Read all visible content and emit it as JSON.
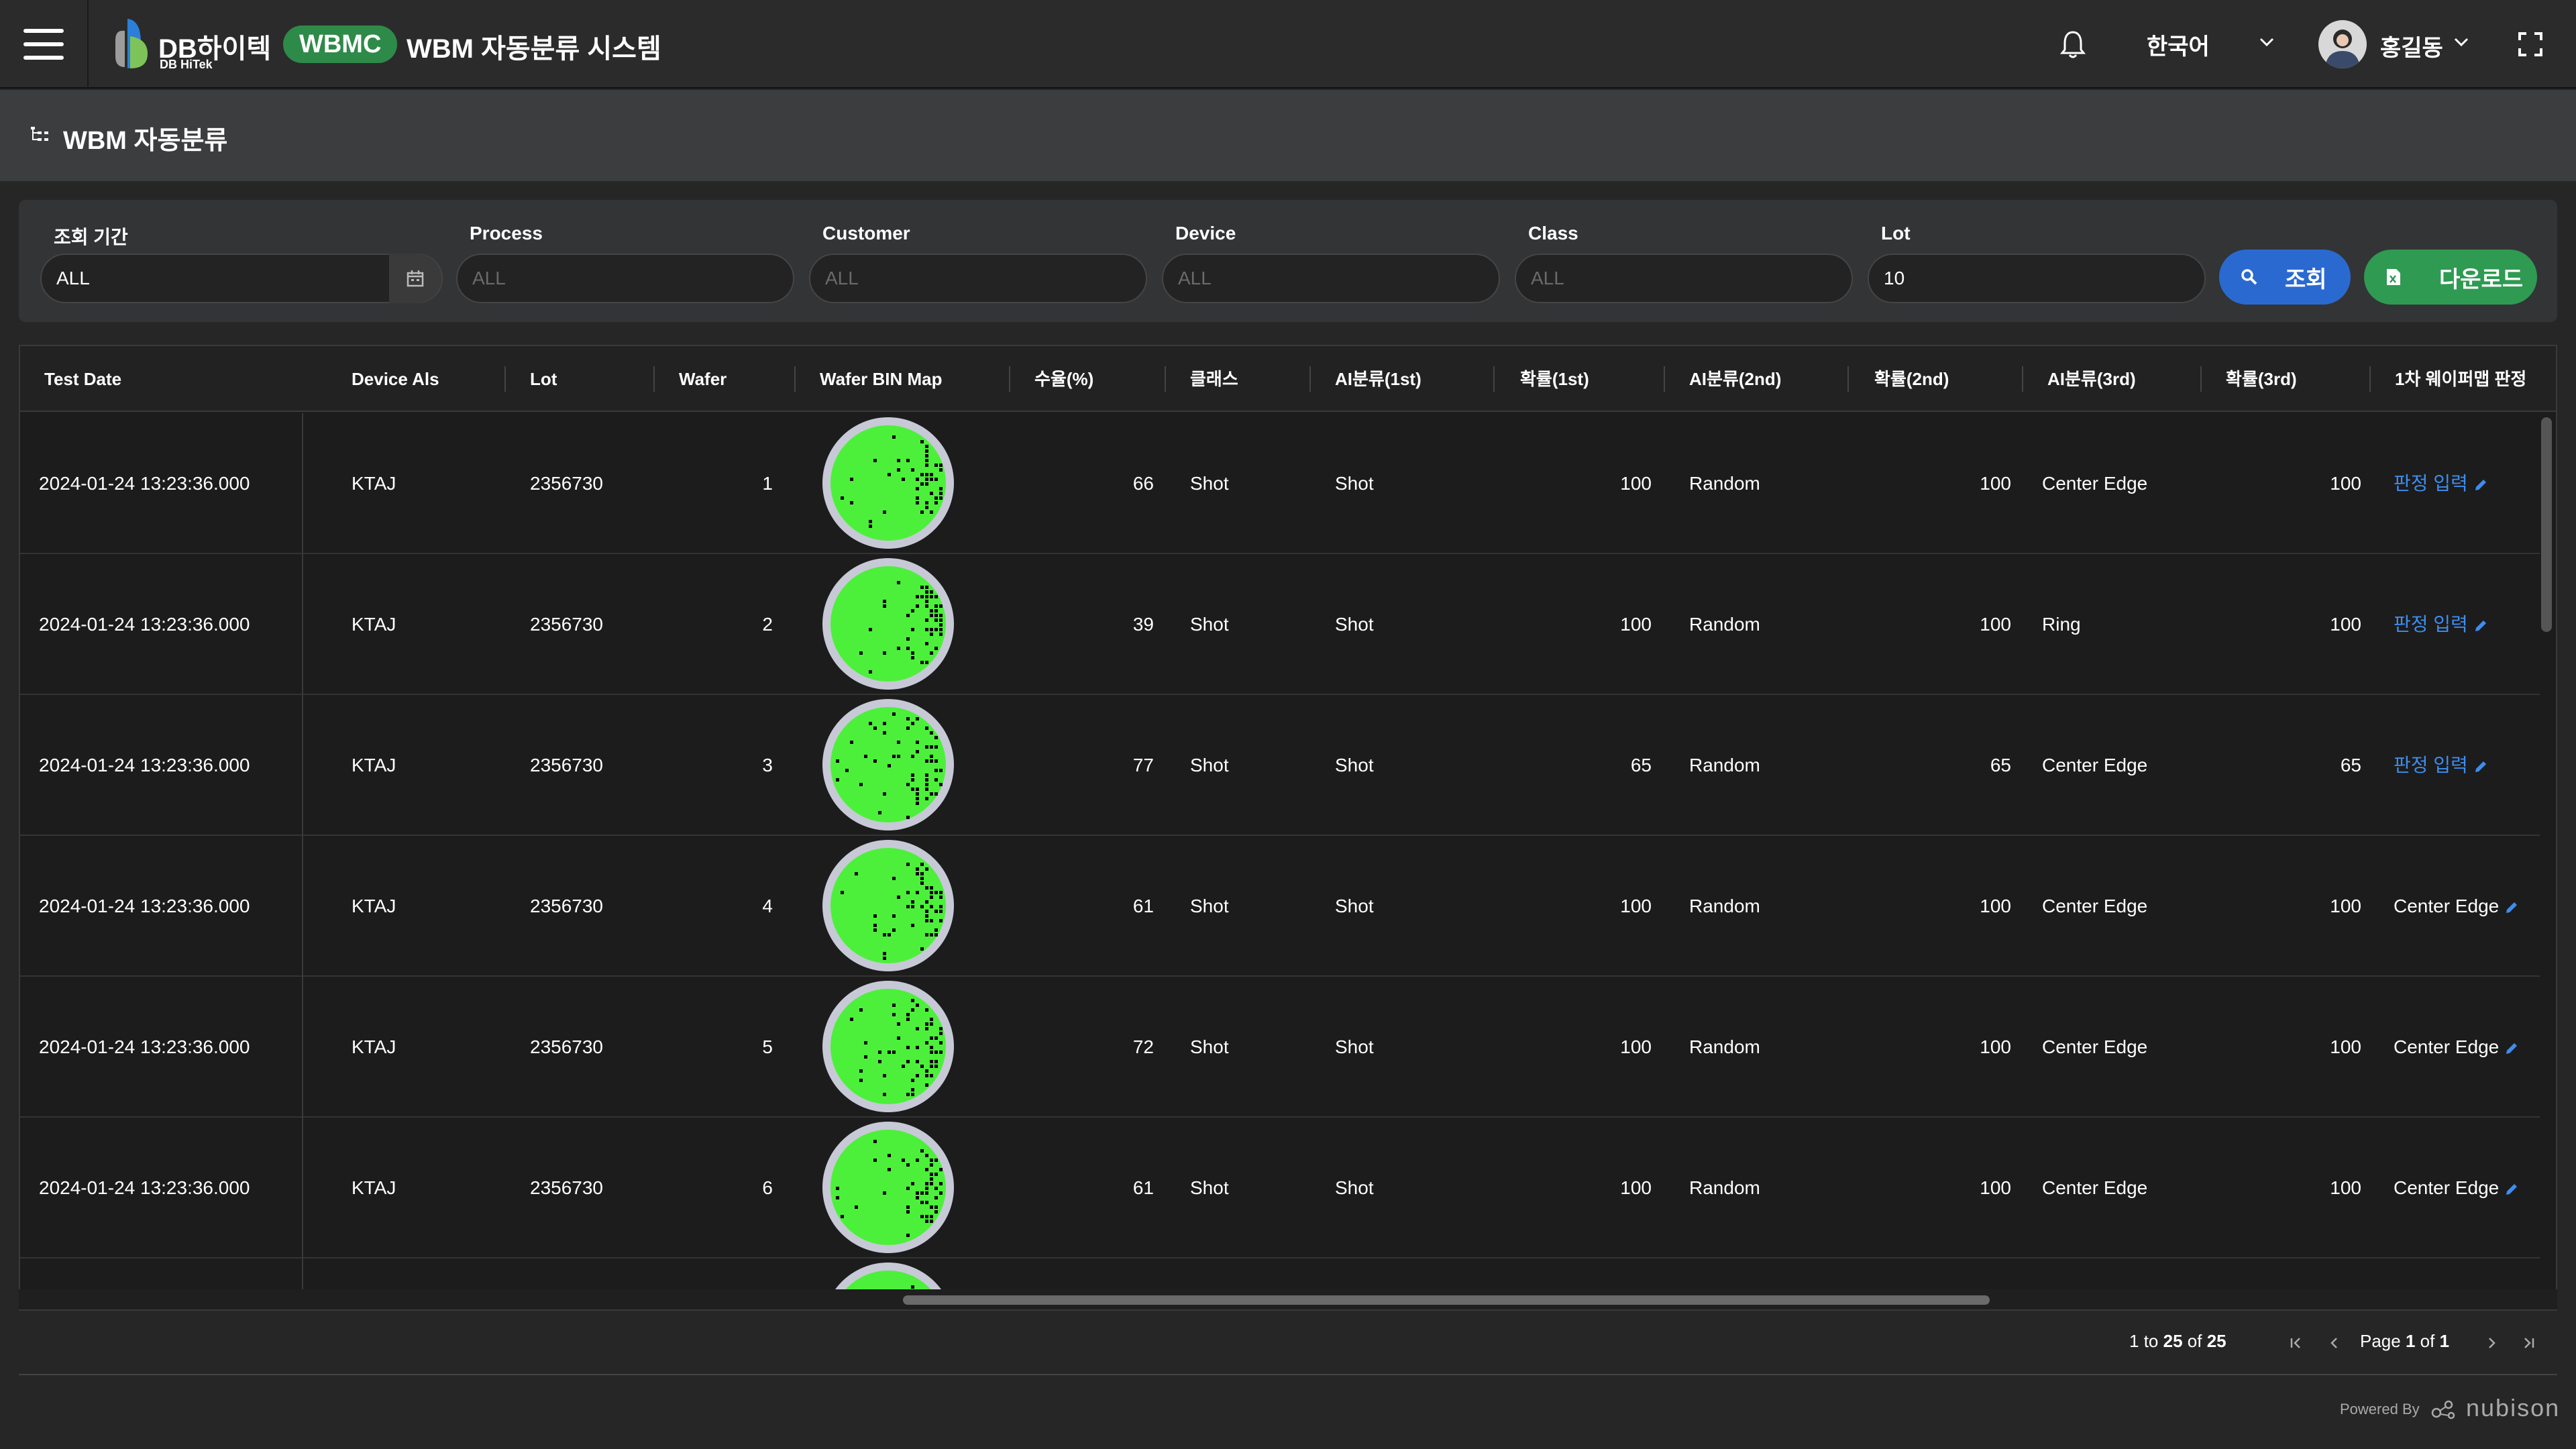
{
  "app": {
    "brand": "DB하이텍",
    "brand_sub": "DB HiTek",
    "badge": "WBMC",
    "title": "WBM 자동분류 시스템",
    "language": "한국어",
    "user": "홍길동"
  },
  "page": {
    "title": "WBM 자동분류"
  },
  "filters": {
    "period_label": "조회 기간",
    "period_value": "ALL",
    "process_label": "Process",
    "process_placeholder": "ALL",
    "customer_label": "Customer",
    "customer_placeholder": "ALL",
    "device_label": "Device",
    "device_placeholder": "ALL",
    "class_label": "Class",
    "class_placeholder": "ALL",
    "lot_label": "Lot",
    "lot_value": "10",
    "search_label": "조회",
    "download_label": "다운로드"
  },
  "table": {
    "columns": [
      "Test Date",
      "Device Als",
      "Lot",
      "Wafer",
      "Wafer BIN Map",
      "수율(%)",
      "클래스",
      "AI분류(1st)",
      "확률(1st)",
      "AI분류(2nd)",
      "확률(2nd)",
      "AI분류(3rd)",
      "확률(3rd)",
      "1차 웨이퍼맵 판정"
    ],
    "rows": [
      {
        "date": "2024-01-24 13:23:36.000",
        "device": "KTAJ",
        "lot": "2356730",
        "wafer": "1",
        "yield": "66",
        "class": "Shot",
        "ai1": "Shot",
        "p1": "100",
        "ai2": "Random",
        "p2": "100",
        "ai3": "Center Edge",
        "p3": "100",
        "judge": "판정 입력",
        "judge_link": true
      },
      {
        "date": "2024-01-24 13:23:36.000",
        "device": "KTAJ",
        "lot": "2356730",
        "wafer": "2",
        "yield": "39",
        "class": "Shot",
        "ai1": "Shot",
        "p1": "100",
        "ai2": "Random",
        "p2": "100",
        "ai3": "Ring",
        "p3": "100",
        "judge": "판정 입력",
        "judge_link": true
      },
      {
        "date": "2024-01-24 13:23:36.000",
        "device": "KTAJ",
        "lot": "2356730",
        "wafer": "3",
        "yield": "77",
        "class": "Shot",
        "ai1": "Shot",
        "p1": "65",
        "ai2": "Random",
        "p2": "65",
        "ai3": "Center Edge",
        "p3": "65",
        "judge": "판정 입력",
        "judge_link": true
      },
      {
        "date": "2024-01-24 13:23:36.000",
        "device": "KTAJ",
        "lot": "2356730",
        "wafer": "4",
        "yield": "61",
        "class": "Shot",
        "ai1": "Shot",
        "p1": "100",
        "ai2": "Random",
        "p2": "100",
        "ai3": "Center Edge",
        "p3": "100",
        "judge": "Center Edge",
        "judge_link": false
      },
      {
        "date": "2024-01-24 13:23:36.000",
        "device": "KTAJ",
        "lot": "2356730",
        "wafer": "5",
        "yield": "72",
        "class": "Shot",
        "ai1": "Shot",
        "p1": "100",
        "ai2": "Random",
        "p2": "100",
        "ai3": "Center Edge",
        "p3": "100",
        "judge": "Center Edge",
        "judge_link": false
      },
      {
        "date": "2024-01-24 13:23:36.000",
        "device": "KTAJ",
        "lot": "2356730",
        "wafer": "6",
        "yield": "61",
        "class": "Shot",
        "ai1": "Shot",
        "p1": "100",
        "ai2": "Random",
        "p2": "100",
        "ai3": "Center Edge",
        "p3": "100",
        "judge": "Center Edge",
        "judge_link": false
      }
    ]
  },
  "pagination": {
    "range_from": "1",
    "range_to": "25",
    "range_total": "25",
    "range_to_word": "to",
    "range_of_word": "of",
    "page_word": "Page",
    "page_current": "1",
    "page_of_word": "of",
    "page_total": "1"
  },
  "footer": {
    "powered_by": "Powered By",
    "vendor": "nubison"
  },
  "colors": {
    "accent_blue": "#2a6ad0",
    "accent_green": "#2f9a52",
    "wafer_green": "#4cf03a"
  }
}
